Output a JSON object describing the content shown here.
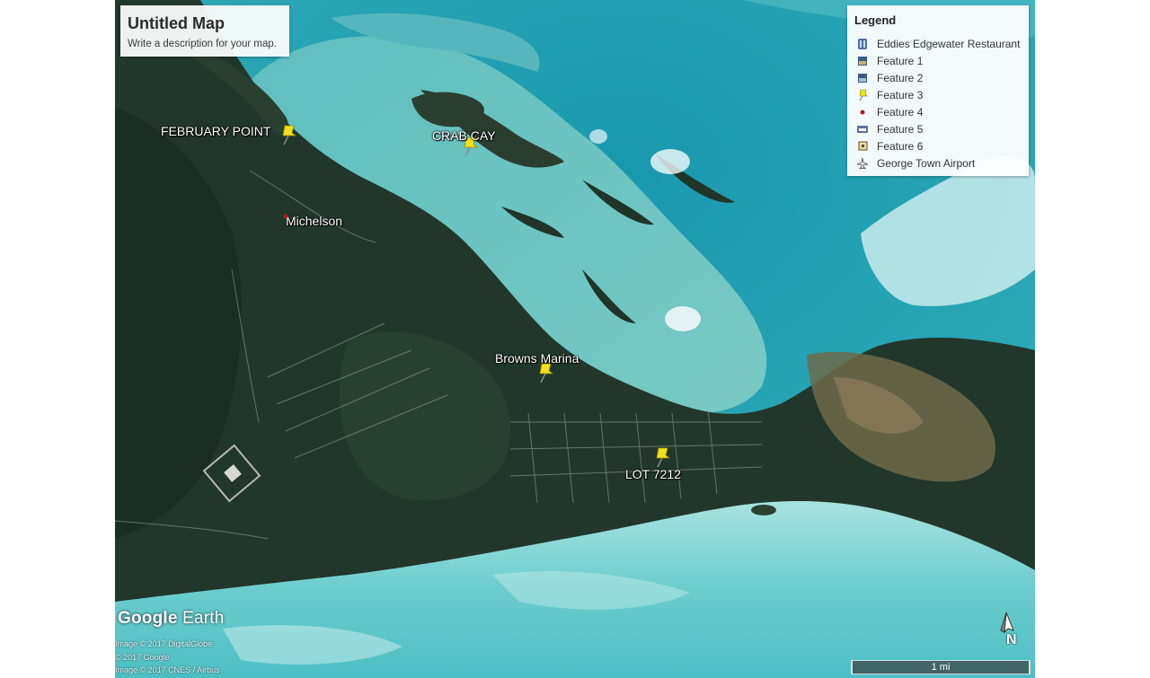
{
  "map": {
    "title": "Untitled Map",
    "description": "Write a description for your map.",
    "colors": {
      "land_dark": "#1f3327",
      "land_mid": "#2d4433",
      "shallow_water": "#6fc6c4",
      "deep_water": "#1f8fa6",
      "pin": "#f0e11c",
      "wetland": "#8a7a5a"
    }
  },
  "legend": {
    "heading": "Legend",
    "items": [
      {
        "label": "Eddies Edgewater Restaurant",
        "icon": "restaurant-icon"
      },
      {
        "label": "Feature 1",
        "icon": "photo-icon"
      },
      {
        "label": "Feature 2",
        "icon": "photo-icon"
      },
      {
        "label": "Feature 3",
        "icon": "yellow-pushpin-icon"
      },
      {
        "label": "Feature 4",
        "icon": "red-dot-icon"
      },
      {
        "label": "Feature 5",
        "icon": "lodging-icon"
      },
      {
        "label": "Feature 6",
        "icon": "square-marker-icon"
      },
      {
        "label": "George Town Airport",
        "icon": "airport-icon"
      }
    ]
  },
  "places": {
    "february_point": "FEBRUARY POINT",
    "crab_cay": "CRAB CAY",
    "michelson": "Michelson",
    "browns_marina": "Browns Marina",
    "lot_7212": "LOT 7212"
  },
  "branding": {
    "logo_google": "Google",
    "logo_earth": "Earth",
    "credits": [
      "Image © 2017 DigitalGlobe",
      "© 2017 Google",
      "Image © 2017 CNES / Airbus"
    ]
  },
  "scale_bar": {
    "label": "1 mi"
  },
  "compass": {
    "label": "N"
  }
}
